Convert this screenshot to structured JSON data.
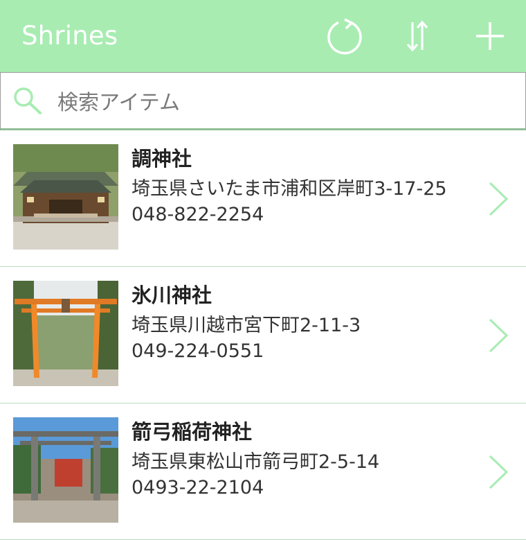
{
  "header": {
    "title": "Shrines",
    "refresh_icon": "refresh-icon",
    "sort_icon": "sort-icon",
    "add_icon": "plus-icon",
    "bg_color": "#a8ecb2"
  },
  "search": {
    "placeholder": "検索アイテム",
    "value": "",
    "icon": "search-icon"
  },
  "shrines": [
    {
      "name": "調神社",
      "address": "埼玉県さいたま市浦和区岸町3-17-25",
      "phone": "048-822-2254",
      "thumbnail": "shrine-hall-photo"
    },
    {
      "name": "氷川神社",
      "address": "埼玉県川越市宮下町2-11-3",
      "phone": "049-224-0551",
      "thumbnail": "torii-gate-photo"
    },
    {
      "name": "箭弓稲荷神社",
      "address": "埼玉県東松山市箭弓町2-5-14",
      "phone": "0493-22-2104",
      "thumbnail": "stone-torii-photo"
    }
  ],
  "colors": {
    "accent": "#a8ecb2",
    "divider": "#b9dcbf",
    "chevron": "#a8ecb2"
  }
}
